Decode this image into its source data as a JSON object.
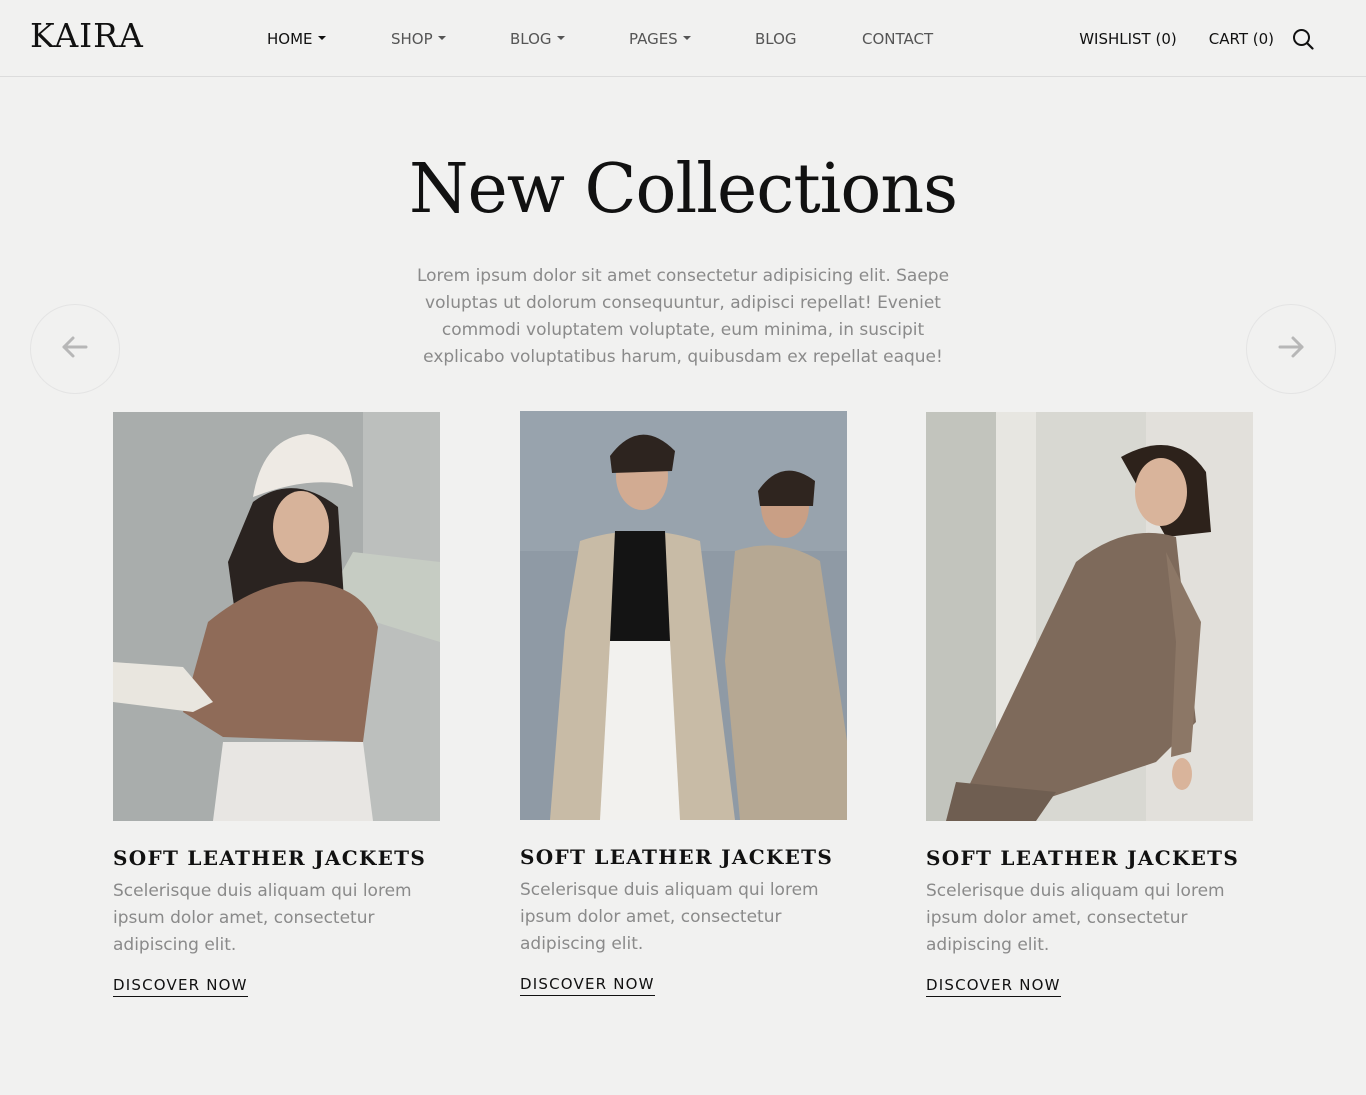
{
  "header": {
    "logo": "KAIRA",
    "nav": [
      {
        "label": "HOME",
        "dropdown": true,
        "active": true
      },
      {
        "label": "SHOP",
        "dropdown": true,
        "active": false
      },
      {
        "label": "BLOG",
        "dropdown": true,
        "active": false
      },
      {
        "label": "PAGES",
        "dropdown": true,
        "active": false
      },
      {
        "label": "BLOG",
        "dropdown": false,
        "active": false
      },
      {
        "label": "CONTACT",
        "dropdown": false,
        "active": false
      }
    ],
    "wishlist": "WISHLIST (0)",
    "cart": "CART (0)",
    "search_icon": "search-icon"
  },
  "hero": {
    "title": "New Collections",
    "description": "Lorem ipsum dolor sit amet consectetur adipisicing elit. Saepe voluptas ut dolorum consequuntur, adipisci repellat! Eveniet commodi voluptatem voluptate, eum minima, in suscipit explicabo voluptatibus harum, quibusdam ex repellat eaque!",
    "prev_icon": "arrow-left-icon",
    "next_icon": "arrow-right-icon"
  },
  "cards": [
    {
      "title": "SOFT LEATHER JACKETS",
      "description": "Scelerisque duis aliquam qui lorem ipsum dolor amet, consectetur adipiscing elit.",
      "link": "DISCOVER NOW"
    },
    {
      "title": "SOFT LEATHER JACKETS",
      "description": "Scelerisque duis aliquam qui lorem ipsum dolor amet, consectetur adipiscing elit.",
      "link": "DISCOVER NOW"
    },
    {
      "title": "SOFT LEATHER JACKETS",
      "description": "Scelerisque duis aliquam qui lorem ipsum dolor amet, consectetur adipiscing elit.",
      "link": "DISCOVER NOW"
    }
  ],
  "colors": {
    "background": "#f1f1f0",
    "text": "#111111",
    "muted": "#8a8a8a"
  }
}
